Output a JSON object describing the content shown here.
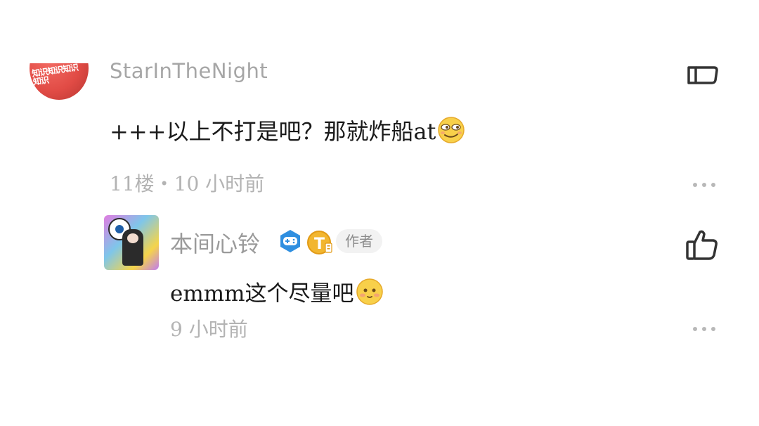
{
  "comments": [
    {
      "username": "StarInTheNight",
      "avatar_text": "知识知识知识知识",
      "text": "+++以上不打是吧？那就炸船at",
      "emoji": "smug-face-emoji",
      "meta": "11楼・10 小时前"
    }
  ],
  "reply": {
    "username": "本间心铃",
    "author_tag": "作者",
    "badge_level": "T",
    "text": "emmm这个尽量吧",
    "emoji": "blushing-face-emoji",
    "meta": "9 小时前"
  },
  "colors": {
    "text_primary": "#1a1a1a",
    "text_muted": "#b3b3b3",
    "username": "#9a9a9a",
    "badge_blue": "#2f8fe0",
    "badge_gold": "#f2b62f"
  }
}
